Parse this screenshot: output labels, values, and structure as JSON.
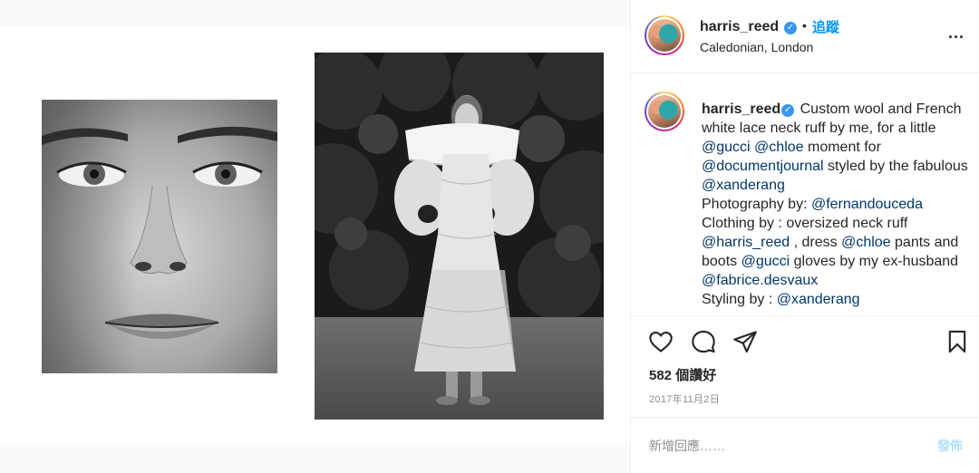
{
  "post": {
    "username": "harris_reed",
    "verified_mark": "✓",
    "dot": "•",
    "follow_label": "追蹤",
    "location": "Caledonian, London",
    "more_label": "...",
    "caption": {
      "username": "harris_reed",
      "segments": [
        {
          "type": "text",
          "value": " Custom wool and French white lace neck ruff by me, for a little "
        },
        {
          "type": "mention",
          "value": "@gucci"
        },
        {
          "type": "text",
          "value": " "
        },
        {
          "type": "mention",
          "value": "@chloe"
        },
        {
          "type": "text",
          "value": " moment for "
        },
        {
          "type": "mention",
          "value": "@documentjournal"
        },
        {
          "type": "text",
          "value": " styled by the fabulous "
        },
        {
          "type": "mention",
          "value": "@xanderang"
        },
        {
          "type": "break"
        },
        {
          "type": "text",
          "value": "Photography by: "
        },
        {
          "type": "mention",
          "value": "@fernandouceda"
        },
        {
          "type": "break"
        },
        {
          "type": "text",
          "value": "Clothing by : oversized neck ruff "
        },
        {
          "type": "mention",
          "value": "@harris_reed"
        },
        {
          "type": "text",
          "value": " , dress "
        },
        {
          "type": "mention",
          "value": "@chloe"
        },
        {
          "type": "text",
          "value": " pants and boots "
        },
        {
          "type": "mention",
          "value": "@gucci"
        },
        {
          "type": "text",
          "value": " gloves by my ex-husband "
        },
        {
          "type": "mention",
          "value": "@fabrice.desvaux"
        },
        {
          "type": "break"
        },
        {
          "type": "text",
          "value": "Styling by : "
        },
        {
          "type": "mention",
          "value": "@xanderang"
        }
      ]
    },
    "likes": "582 個讚好",
    "date": "2017年11月2日",
    "comment_placeholder": "新增回應……",
    "post_label": "發佈"
  },
  "icons": {
    "like": "heart-icon",
    "comment": "comment-bubble-icon",
    "share": "paper-plane-icon",
    "save": "bookmark-icon",
    "more": "more-options-icon",
    "verified": "verified-badge-icon"
  },
  "colors": {
    "accent_blue": "#0095f6",
    "mention_blue": "#00376b",
    "verified_blue": "#3897f0",
    "post_disabled": "#b2dffc",
    "muted": "#8e8e8e",
    "text": "#262626"
  }
}
